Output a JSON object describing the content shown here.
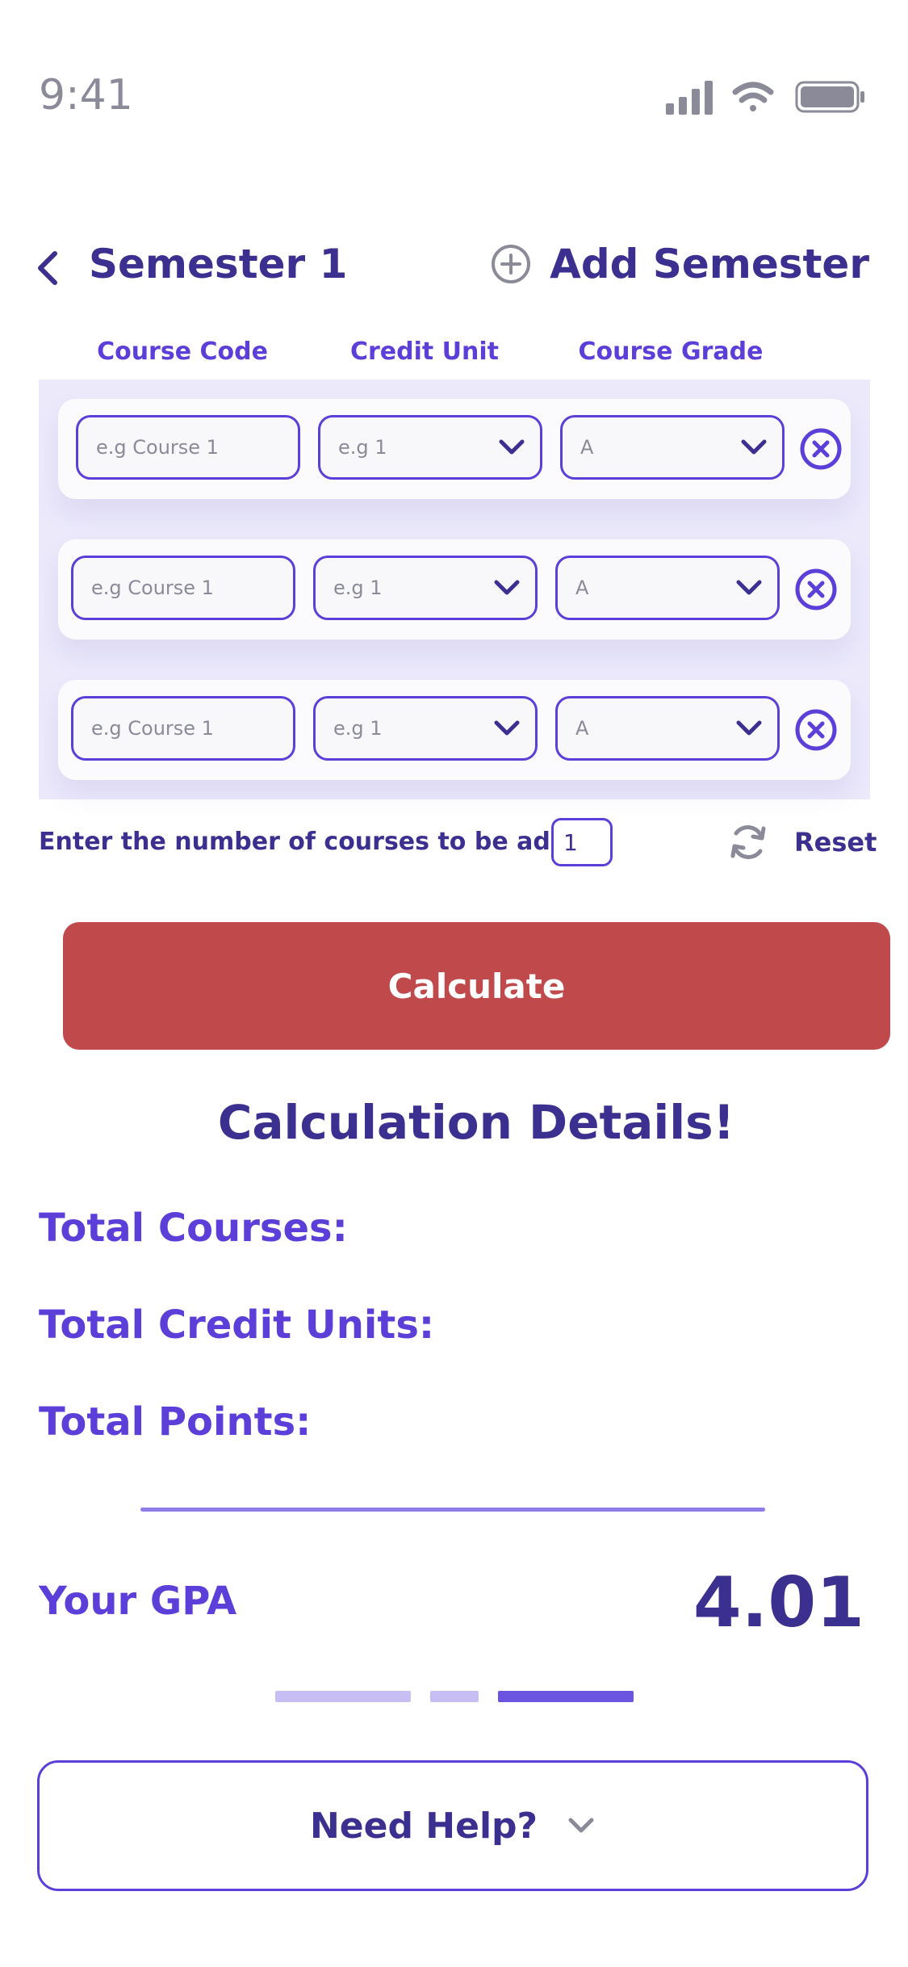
{
  "status_bar": {
    "time": "9:41",
    "icons": [
      "signal-icon",
      "wifi-icon",
      "battery-icon"
    ]
  },
  "header": {
    "title": "Semester 1",
    "add_label": "Add Semester"
  },
  "columns": {
    "code": "Course Code",
    "credit": "Credit Unit",
    "grade": "Course Grade"
  },
  "courses": [
    {
      "code_placeholder": "e.g Course 1",
      "credit": "e.g  1",
      "grade": "A"
    },
    {
      "code_placeholder": "e.g Course 1",
      "credit": "e.g  1",
      "grade": "A"
    },
    {
      "code_placeholder": "e.g Course 1",
      "credit": "e.g  1",
      "grade": "A"
    }
  ],
  "course_count": {
    "label": "Enter the number of  courses to be added",
    "value": "1"
  },
  "reset_label": "Reset",
  "calculate_label": "Calculate",
  "details": {
    "title": "Calculation Details!",
    "total_courses": "Total Courses:",
    "total_credit_units": "Total Credit Units:",
    "total_points": "Total Points:",
    "gpa_label": "Your GPA",
    "gpa_value": "4.01"
  },
  "pager": {
    "pages": 3,
    "active": 3
  },
  "help_label": "Need Help?",
  "colors": {
    "primary": "#3b2f8f",
    "accent": "#5b3fd8",
    "calculate": "#c0494b",
    "panel": "#ebe9fa"
  }
}
